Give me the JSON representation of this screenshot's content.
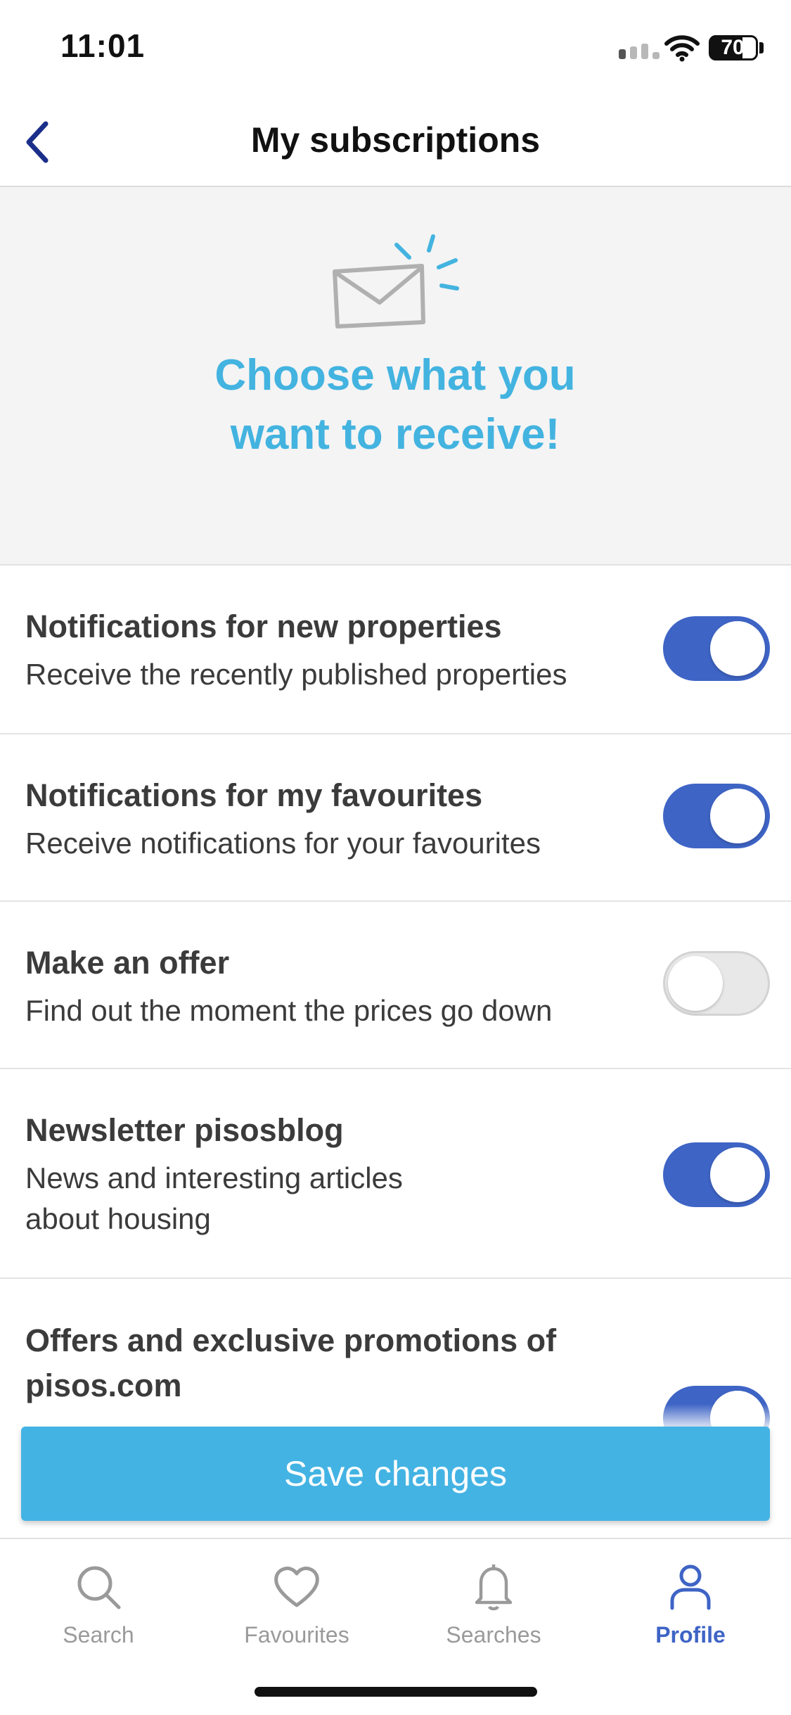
{
  "status_bar": {
    "time": "11:01",
    "battery": "70"
  },
  "header": {
    "title": "My subscriptions",
    "back_icon": "chevron-left-icon"
  },
  "hero": {
    "icon": "envelope-icon",
    "title": "Choose what you want to receive!"
  },
  "options": [
    {
      "title": "Notifications for new properties",
      "desc": "Receive the recently published properties",
      "enabled": true
    },
    {
      "title": "Notifications for my favourites",
      "desc": "Receive notifications for your favourites",
      "enabled": true
    },
    {
      "title": "Make an offer",
      "desc": "Find out the moment the prices go down",
      "enabled": false
    },
    {
      "title": "Newsletter pisosblog",
      "desc": "News and interesting articles about housing",
      "enabled": true
    },
    {
      "title": "Offers and exclusive promotions of pisos.com",
      "desc": "",
      "enabled": true
    }
  ],
  "save_button": {
    "label": "Save changes"
  },
  "tabbar": {
    "tabs": [
      {
        "label": "Search",
        "icon": "search-icon",
        "active": false
      },
      {
        "label": "Favourites",
        "icon": "heart-icon",
        "active": false
      },
      {
        "label": "Searches",
        "icon": "bell-icon",
        "active": false
      },
      {
        "label": "Profile",
        "icon": "user-icon",
        "active": true
      }
    ]
  },
  "colors": {
    "accent": "#3e64c5",
    "brand": "#43b3e0",
    "toggle_off": "#e8e8e8"
  }
}
